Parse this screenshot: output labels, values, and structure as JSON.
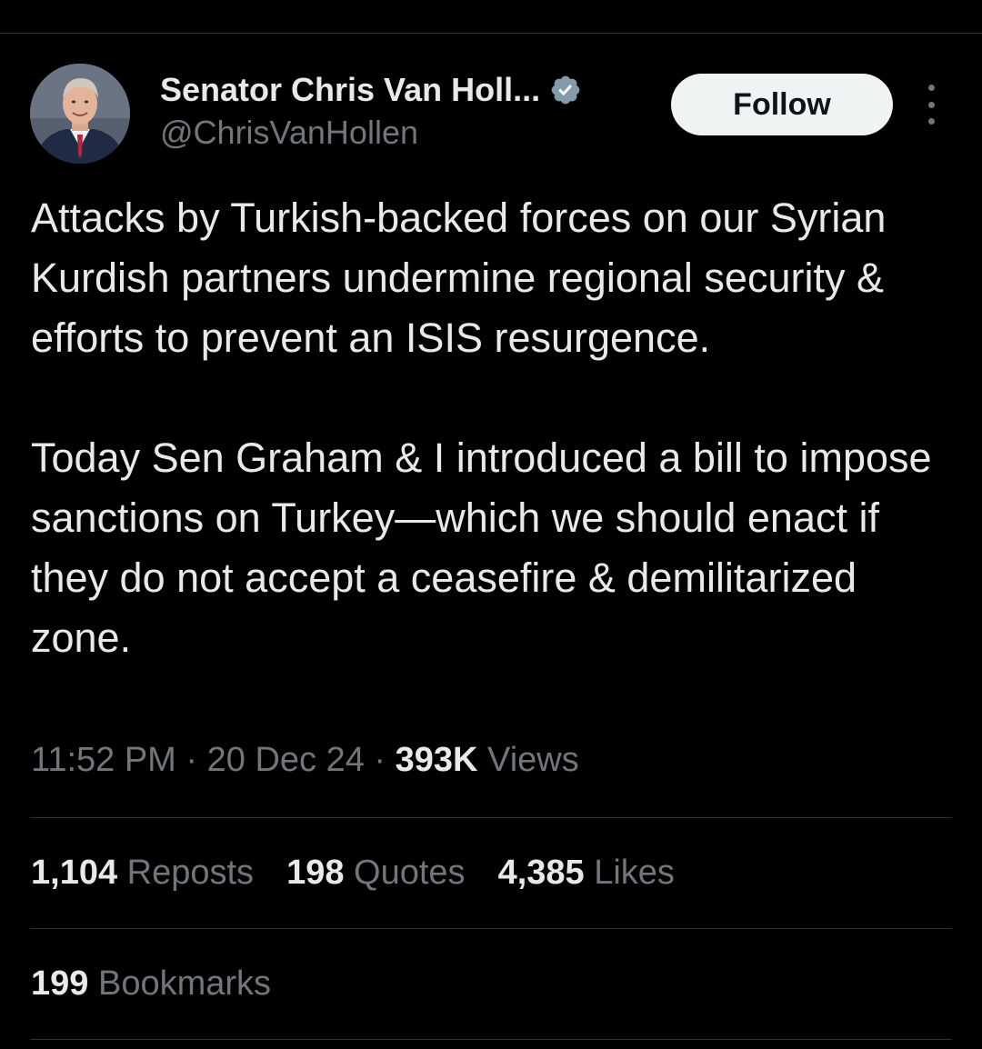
{
  "author": {
    "display_name": "Senator Chris Van Holl...",
    "handle": "@ChrisVanHollen",
    "verified_icon": "verified-badge-icon",
    "avatar_icon": "avatar-photo"
  },
  "follow_button": {
    "label": "Follow"
  },
  "more_icon": "more-vertical-icon",
  "tweet": {
    "paragraphs": [
      "Attacks by Turkish-backed forces on our Syrian Kurdish partners undermine regional security & efforts to prevent an ISIS resurgence.",
      "Today Sen Graham & I introduced a bill to impose sanctions on Turkey—which we should enact if they do not accept a ceasefire & demilitarized zone."
    ]
  },
  "meta": {
    "time": "11:52 PM",
    "separator": " · ",
    "date": "20 Dec 24",
    "views_count": "393K",
    "views_label": "Views"
  },
  "stats": {
    "reposts": {
      "count": "1,104",
      "label": "Reposts"
    },
    "quotes": {
      "count": "198",
      "label": "Quotes"
    },
    "likes": {
      "count": "4,385",
      "label": "Likes"
    },
    "bookmarks": {
      "count": "199",
      "label": "Bookmarks"
    }
  },
  "colors": {
    "background": "#000000",
    "text_primary": "#e7e9ea",
    "text_secondary": "#71767b",
    "divider": "#2f3336",
    "verified_badge": "#829aab",
    "follow_bg": "#eff3f4"
  }
}
